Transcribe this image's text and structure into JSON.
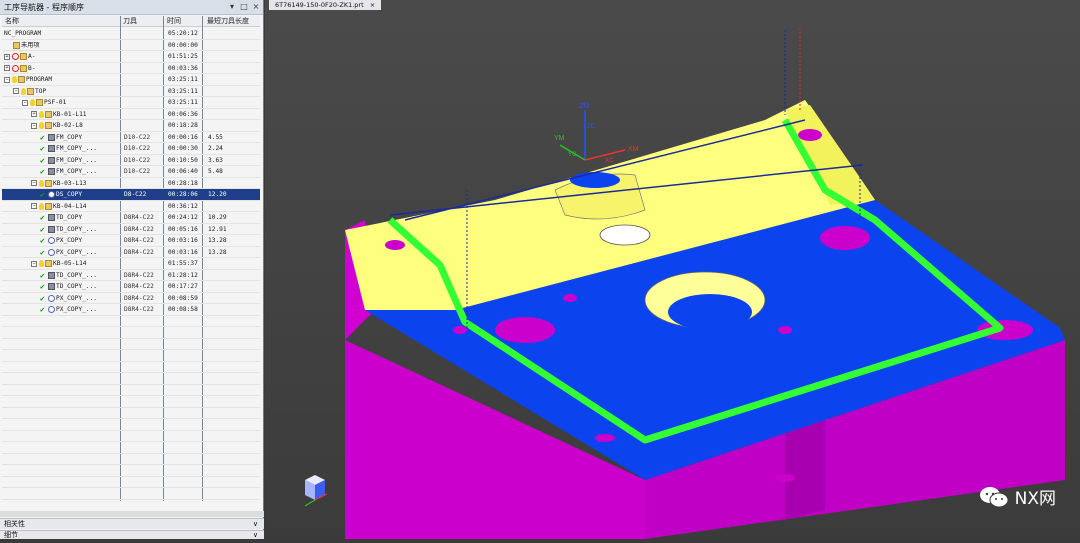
{
  "navigator": {
    "title": "工序导航器 - 程序顺序",
    "columns": {
      "name": "名称",
      "tool": "刀具",
      "time": "时间",
      "length": "最短刀具长度"
    },
    "rows": [
      {
        "name": "NC_PROGRAM",
        "tool": "",
        "time": "05:20:12",
        "length": "",
        "indent": 0,
        "expander": "",
        "icons": []
      },
      {
        "name": "未用项",
        "tool": "",
        "time": "00:00:00",
        "length": "",
        "indent": 1,
        "expander": "",
        "icons": [
          "folder"
        ]
      },
      {
        "name": "A-",
        "tool": "",
        "time": "01:51:25",
        "length": "",
        "indent": 0,
        "expander": "+",
        "icons": [
          "noentry",
          "folder"
        ]
      },
      {
        "name": "B-",
        "tool": "",
        "time": "00:03:36",
        "length": "",
        "indent": 0,
        "expander": "+",
        "icons": [
          "noentry",
          "folder"
        ]
      },
      {
        "name": "PROGRAM",
        "tool": "",
        "time": "03:25:11",
        "length": "",
        "indent": 0,
        "expander": "-",
        "icons": [
          "bulb",
          "folder"
        ]
      },
      {
        "name": "TOP",
        "tool": "",
        "time": "03:25:11",
        "length": "",
        "indent": 1,
        "expander": "-",
        "icons": [
          "bulb",
          "folder"
        ]
      },
      {
        "name": "PSF-01",
        "tool": "",
        "time": "03:25:11",
        "length": "",
        "indent": 2,
        "expander": "-",
        "icons": [
          "bulb",
          "folder"
        ]
      },
      {
        "name": "KB-01-L11",
        "tool": "",
        "time": "00:06:36",
        "length": "",
        "indent": 3,
        "expander": "+",
        "icons": [
          "bulb",
          "folder"
        ]
      },
      {
        "name": "KB-02-L8",
        "tool": "",
        "time": "00:18:28",
        "length": "",
        "indent": 3,
        "expander": "-",
        "icons": [
          "bulb",
          "folder"
        ]
      },
      {
        "name": "FM_COPY",
        "tool": "D10-C22",
        "time": "00:00:16",
        "length": "4.55",
        "indent": 4,
        "expander": "",
        "icons": [
          "check",
          "op"
        ]
      },
      {
        "name": "FM_COPY_...",
        "tool": "D10-C22",
        "time": "00:00:30",
        "length": "2.24",
        "indent": 4,
        "expander": "",
        "icons": [
          "check",
          "op"
        ]
      },
      {
        "name": "FM_COPY_...",
        "tool": "D10-C22",
        "time": "00:10:50",
        "length": "3.63",
        "indent": 4,
        "expander": "",
        "icons": [
          "check",
          "op"
        ]
      },
      {
        "name": "FM_COPY_...",
        "tool": "D10-C22",
        "time": "00:06:40",
        "length": "5.48",
        "indent": 4,
        "expander": "",
        "icons": [
          "check",
          "op"
        ]
      },
      {
        "name": "KB-03-L13",
        "tool": "",
        "time": "00:28:18",
        "length": "",
        "indent": 3,
        "expander": "-",
        "icons": [
          "bulb",
          "folder"
        ]
      },
      {
        "name": "DS_COPY",
        "tool": "D8-C22",
        "time": "00:28:06",
        "length": "12.20",
        "indent": 4,
        "expander": "",
        "icons": [
          "check",
          "opc"
        ],
        "selected": true
      },
      {
        "name": "KB-04-L14",
        "tool": "",
        "time": "00:36:12",
        "length": "",
        "indent": 3,
        "expander": "-",
        "icons": [
          "bulb",
          "folder"
        ]
      },
      {
        "name": "TD_COPY",
        "tool": "D8R4-C22",
        "time": "00:24:12",
        "length": "10.29",
        "indent": 4,
        "expander": "",
        "icons": [
          "check",
          "op"
        ]
      },
      {
        "name": "TD_COPY_...",
        "tool": "D8R4-C22",
        "time": "00:05:16",
        "length": "12.91",
        "indent": 4,
        "expander": "",
        "icons": [
          "check",
          "op"
        ]
      },
      {
        "name": "PX_COPY",
        "tool": "D8R4-C22",
        "time": "00:03:16",
        "length": "13.28",
        "indent": 4,
        "expander": "",
        "icons": [
          "check",
          "opc"
        ]
      },
      {
        "name": "PX_COPY_...",
        "tool": "D8R4-C22",
        "time": "00:03:16",
        "length": "13.28",
        "indent": 4,
        "expander": "",
        "icons": [
          "check",
          "opc"
        ]
      },
      {
        "name": "KB-05-L14",
        "tool": "",
        "time": "01:55:37",
        "length": "",
        "indent": 3,
        "expander": "-",
        "icons": [
          "bulb",
          "folder"
        ]
      },
      {
        "name": "TD_COPY_...",
        "tool": "D8R4-C22",
        "time": "01:28:12",
        "length": "",
        "indent": 4,
        "expander": "",
        "icons": [
          "check",
          "op"
        ]
      },
      {
        "name": "TD_COPY_...",
        "tool": "D8R4-C22",
        "time": "00:17:27",
        "length": "",
        "indent": 4,
        "expander": "",
        "icons": [
          "check",
          "op"
        ]
      },
      {
        "name": "PX_COPY_...",
        "tool": "D8R4-C22",
        "time": "00:08:59",
        "length": "",
        "indent": 4,
        "expander": "",
        "icons": [
          "check",
          "opc"
        ]
      },
      {
        "name": "PX_COPY_...",
        "tool": "D8R4-C22",
        "time": "00:08:58",
        "length": "",
        "indent": 4,
        "expander": "",
        "icons": [
          "check",
          "opc"
        ]
      }
    ],
    "bottom_panel_1": "相关性",
    "bottom_panel_2": "细节"
  },
  "viewport": {
    "tab_label": "6T76149-150-0F20-ZK1.prt",
    "axis_labels": {
      "zm": "ZM",
      "ym": "YM",
      "xm": "XM",
      "zc": "ZC",
      "yc": "YC",
      "xc": "XC"
    },
    "watermark": "NX网"
  },
  "colors": {
    "selected_row": "#1f3f8a",
    "part_yellow": "#ffff7f",
    "part_blue": "#0b44ee",
    "part_magenta": "#cc00cc",
    "toolpath_green": "#33ff33",
    "background": "#3d3d3d"
  }
}
